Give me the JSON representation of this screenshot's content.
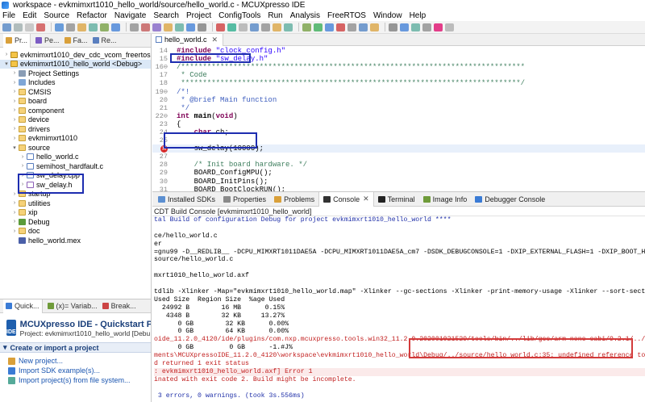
{
  "window": {
    "title": "workspace - evkmimxrt1010_hello_world/source/hello_world.c - MCUXpresso IDE"
  },
  "menu": [
    "File",
    "Edit",
    "Source",
    "Refactor",
    "Navigate",
    "Search",
    "Project",
    "ConfigTools",
    "Run",
    "Analysis",
    "FreeRTOS",
    "Window",
    "Help"
  ],
  "left_tabs": [
    {
      "label": "Pr...",
      "active": true
    },
    {
      "label": "Pe..."
    },
    {
      "label": "Fa..."
    },
    {
      "label": "Re..."
    }
  ],
  "tree": [
    {
      "label": "evkmimxrt1010_dev_cdc_vcom_freertos",
      "indent": 0,
      "arrow": ">",
      "icon": "project"
    },
    {
      "label": "evkmimxrt1010_hello_world <Debug>",
      "indent": 0,
      "arrow": "v",
      "icon": "project",
      "selected": true
    },
    {
      "label": "Project Settings",
      "indent": 1,
      "arrow": ">",
      "icon": "settings"
    },
    {
      "label": "Includes",
      "indent": 1,
      "arrow": ">",
      "icon": "include"
    },
    {
      "label": "CMSIS",
      "indent": 1,
      "arrow": ">",
      "icon": "folder"
    },
    {
      "label": "board",
      "indent": 1,
      "arrow": ">",
      "icon": "folder"
    },
    {
      "label": "component",
      "indent": 1,
      "arrow": ">",
      "icon": "folder"
    },
    {
      "label": "device",
      "indent": 1,
      "arrow": ">",
      "icon": "folder"
    },
    {
      "label": "drivers",
      "indent": 1,
      "arrow": ">",
      "icon": "folder"
    },
    {
      "label": "evkmimxrt1010",
      "indent": 1,
      "arrow": ">",
      "icon": "folder"
    },
    {
      "label": "source",
      "indent": 1,
      "arrow": "v",
      "icon": "folder"
    },
    {
      "label": "hello_world.c",
      "indent": 2,
      "arrow": ">",
      "icon": "c"
    },
    {
      "label": "semihost_hardfault.c",
      "indent": 2,
      "arrow": ">",
      "icon": "c"
    },
    {
      "label": "sw_delay.cpp",
      "indent": 2,
      "arrow": ">",
      "icon": "c"
    },
    {
      "label": "sw_delay.h",
      "indent": 2,
      "arrow": ">",
      "icon": "h"
    },
    {
      "label": "startup",
      "indent": 1,
      "arrow": ">",
      "icon": "folder"
    },
    {
      "label": "utilities",
      "indent": 1,
      "arrow": ">",
      "icon": "folder"
    },
    {
      "label": "xip",
      "indent": 1,
      "arrow": ">",
      "icon": "folder"
    },
    {
      "label": "Debug",
      "indent": 1,
      "arrow": ">",
      "icon": "debug"
    },
    {
      "label": "doc",
      "indent": 1,
      "arrow": ">",
      "icon": "folder"
    },
    {
      "label": "hello_world.mex",
      "indent": 1,
      "arrow": "",
      "icon": "mex"
    }
  ],
  "quickstart": {
    "tabs": [
      "Quick...",
      "(x)= Variab...",
      "Break..."
    ],
    "title": "MCUXpresso IDE - Quickstart P",
    "project": "Project: evkmimxrt1010_hello_world [Debu",
    "logo": "IDE",
    "section": "Create or import a project",
    "links": [
      "New project...",
      "Import SDK example(s)...",
      "Import project(s) from file system..."
    ]
  },
  "editor": {
    "tab": "hello_world.c",
    "lines": [
      {
        "num": "14",
        "html": "<span class=\"kw\">#include</span> <span class=\"str\">\"clock_config.h\"</span>"
      },
      {
        "num": "15",
        "html": "<span class=\"kw\">#include</span> <span class=\"str\">\"sw_delay.h\"</span>",
        "changed": true
      },
      {
        "num": "16⊖",
        "html": "<span class=\"cm\">/*******************************************************************************</span>"
      },
      {
        "num": "17",
        "html": "<span class=\"cm\"> * Code</span>"
      },
      {
        "num": "18",
        "html": "<span class=\"cm\"> ******************************************************************************/</span>"
      },
      {
        "num": "19⊖",
        "html": "<span class=\"doc\">/*!</span>"
      },
      {
        "num": "20",
        "html": "<span class=\"doc\"> * @brief Main function</span>"
      },
      {
        "num": "21",
        "html": "<span class=\"doc\"> */</span>"
      },
      {
        "num": "22⊖",
        "html": "<span class=\"kw\">int</span> <b>main</b>(<span class=\"kw\">void</span>)",
        "changed": true
      },
      {
        "num": "23",
        "html": "{",
        "changed": true
      },
      {
        "num": "24",
        "html": "    <span class=\"kw\">char</span> ch;",
        "changed": true
      },
      {
        "num": "25",
        "html": "",
        "changed": true
      },
      {
        "num": "",
        "html": "    sw_delay(10000);",
        "changed": true,
        "error": true,
        "hl": true
      },
      {
        "num": "27",
        "html": "",
        "changed": true
      },
      {
        "num": "28",
        "html": "    <span class=\"cm\">/* Init board hardware. */</span>"
      },
      {
        "num": "29",
        "html": "    BOARD_ConfigMPU();"
      },
      {
        "num": "30",
        "html": "    BOARD_InitPins();"
      },
      {
        "num": "31",
        "html": "    BOARD_BootClockRUN();"
      }
    ]
  },
  "bottom_tabs": [
    {
      "label": "Installed SDKs",
      "color": "#5b8fd1"
    },
    {
      "label": "Properties",
      "color": "#8a8a8a"
    },
    {
      "label": "Problems",
      "color": "#d9a03a"
    },
    {
      "label": "Console",
      "color": "#333",
      "active": true
    },
    {
      "label": "Terminal",
      "color": "#222"
    },
    {
      "label": "Image Info",
      "color": "#6f9b3a"
    },
    {
      "label": "Debugger Console",
      "color": "#3a7bd5"
    }
  ],
  "console": {
    "title": "CDT Build Console [evkmimxrt1010_hello_world]",
    "lines": [
      {
        "text": "tal Build of configuration Debug for project evkmimxrt1010_hello_world ****",
        "cls": "blue"
      },
      {
        "text": ""
      },
      {
        "text": "ce/hello_world.c"
      },
      {
        "text": "er"
      },
      {
        "text": "=gnu99 -D__REDLIB__ -DCPU_MIMXRT1011DAE5A -DCPU_MIMXRT1011DAE5A_cm7 -DSDK_DEBUGCONSOLE=1 -DXIP_EXTERNAL_FLASH=1 -DXIP_BOOT_HEADER_ENABLE=1"
      },
      {
        "text": "source/hello_world.c"
      },
      {
        "text": ""
      },
      {
        "text": "mxrt1010_hello_world.axf"
      },
      {
        "text": ""
      },
      {
        "text": "tdlib -Xlinker -Map=\"evkmimxrt1010_hello_world.map\" -Xlinker --gc-sections -Xlinker -print-memory-usage -Xlinker --sort-section=alignment -"
      },
      {
        "text": "Used Size  Region Size  %age Used"
      },
      {
        "text": "  24992 B        16 MB      0.15%"
      },
      {
        "text": "   4348 B        32 KB     13.27%"
      },
      {
        "text": "      0 GB        32 KB      0.00%"
      },
      {
        "text": "      0 GB        64 KB      0.00%"
      },
      {
        "text": "oide_11.2.0_4120/ide/plugins/com.nxp.mcuxpresso.tools.win32_11.2.0.202001021529/tools/bin/../lib/gcc/arm-none-eabi/9.2.1/../../../../arm-no",
        "cls": "red"
      },
      {
        "text": "      0 GB         0 GB      -1.#J%"
      },
      {
        "text": "ments\\MCUXpressoIDE_11.2.0_4120\\workspace\\evkmimxrt1010_hello_world\\Debug/../source/hello_world.c:35: undefined reference to `sw_delay'",
        "cls": "red"
      },
      {
        "text": "d returned 1 exit status",
        "cls": "red"
      },
      {
        "text": ": evkmimxrt1010_hello_world.axf] Error 1",
        "cls": "red errbg"
      },
      {
        "text": "inated with exit code 2. Build might be incomplete.",
        "cls": "red"
      },
      {
        "text": ""
      },
      {
        "text": " 3 errors, 0 warnings. (took 3s.556ms)",
        "cls": "blue"
      }
    ]
  },
  "colors": {
    "annotation_blue": "#1d2db0",
    "annotation_red": "#d33a3a",
    "error": "#c22020"
  }
}
